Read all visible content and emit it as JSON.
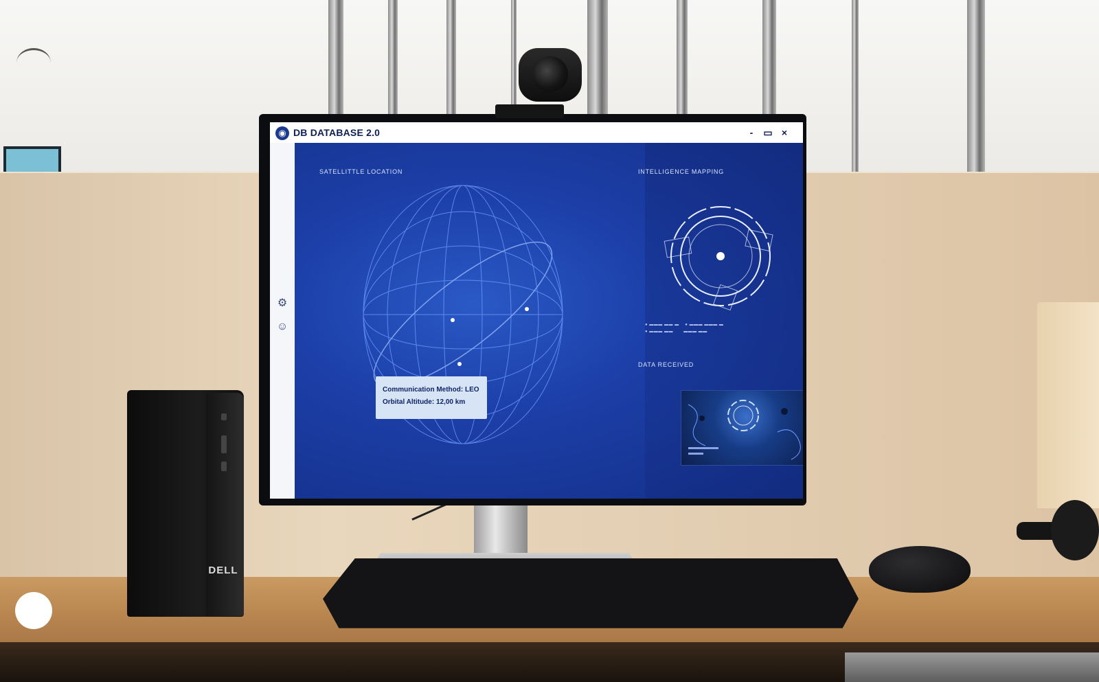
{
  "app": {
    "title": "DB DATABASE 2.0",
    "window_controls": [
      "-",
      "▭",
      "×"
    ]
  },
  "panels": {
    "satellite_location": {
      "label": "SATELLITTLE LOCATION"
    },
    "intelligence_mapping": {
      "label": "INTELLIGENCE MAPPING"
    },
    "data_received": {
      "label": "DATA RECEIVED"
    }
  },
  "info_box": {
    "line1": "Communication Method: LEO",
    "line2": "Orbital Altitude: 12,00 km"
  },
  "tower": {
    "brand": "DELL"
  },
  "colors": {
    "screen_bg": "#1c3fa8",
    "accent": "#d8e3ff",
    "titlebar_text": "#0d1f55"
  },
  "icons": {
    "app_logo": "globe-icon",
    "sidebar": [
      "settings-icon",
      "user-icon"
    ]
  }
}
